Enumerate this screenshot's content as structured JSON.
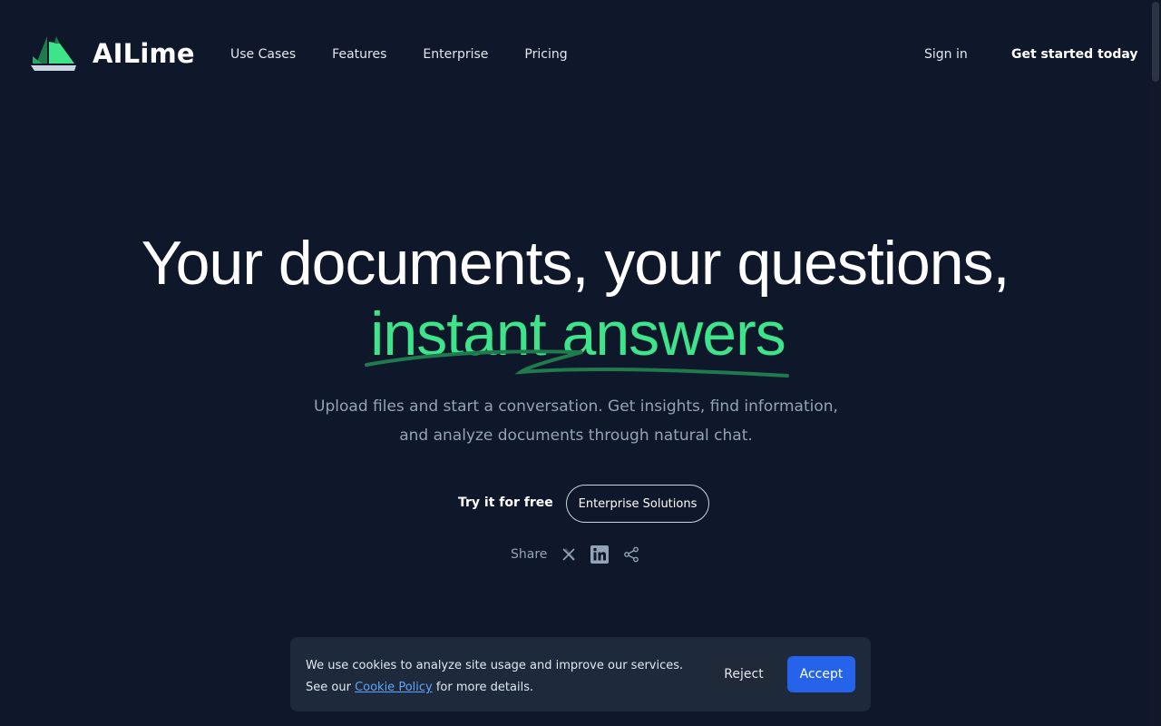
{
  "brand": {
    "name_ai": "AI",
    "name_lime": "Lime",
    "accent_color": "#3ee48a"
  },
  "nav": {
    "items": [
      {
        "label": "Use Cases"
      },
      {
        "label": "Features"
      },
      {
        "label": "Enterprise"
      },
      {
        "label": "Pricing"
      }
    ],
    "sign_in": "Sign in",
    "get_started": "Get started today"
  },
  "hero": {
    "title": "Your documents, your questions,",
    "accent": "instant answers",
    "subtitle": "Upload files and start a conversation. Get insights, find information, and analyze documents through natural chat.",
    "cta_primary": "Try it for free",
    "cta_secondary": "Enterprise Solutions"
  },
  "share": {
    "label": "Share",
    "icons": [
      "x-icon",
      "linkedin-icon",
      "share-icon"
    ]
  },
  "cookie_banner": {
    "text_before": "We use cookies to analyze site usage and improve our services. See our ",
    "link": "Cookie Policy",
    "text_after": " for more details.",
    "reject": "Reject",
    "accept": "Accept",
    "accept_color": "#2563eb"
  }
}
